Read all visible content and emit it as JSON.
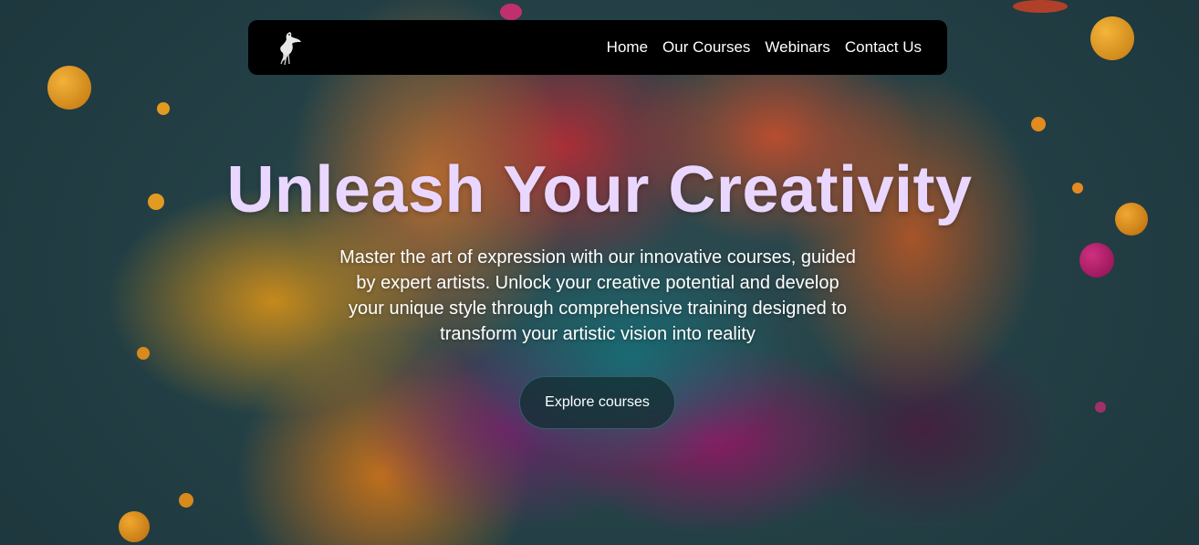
{
  "nav": {
    "logo_icon": "dove-icon",
    "links": [
      "Home",
      "Our Courses",
      "Webinars",
      "Contact Us"
    ]
  },
  "hero": {
    "headline": "Unleash Your Creativity",
    "description": "Master the art of expression with our innovative courses, guided by expert artists. Unlock your creative potential and develop your unique style through comprehensive training designed to transform your artistic vision into reality",
    "cta_label": "Explore courses"
  },
  "colors": {
    "headline": "#ead7ff",
    "nav_background": "#000000",
    "background": "#1e3a41"
  }
}
